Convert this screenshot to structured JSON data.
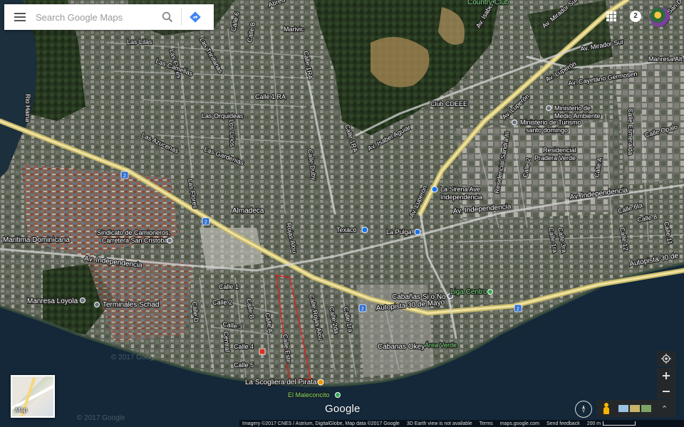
{
  "search": {
    "placeholder": "Search Google Maps"
  },
  "header": {
    "notification_count": "2"
  },
  "layer_switcher": {
    "label": "Map"
  },
  "logo": "Google",
  "watermarks": [
    "© 2017 Google",
    "© 2017 Google"
  ],
  "footer": {
    "imagery": "Imagery ©2017 CNES / Astrium, DigitalGlobe, Map data ©2017 Google",
    "earth_note": "3D Earth view is not available",
    "terms": "Terms",
    "url": "maps.google.com",
    "feedback": "Send feedback",
    "scale": "200 m"
  },
  "map": {
    "street_labels": {
      "calle_6": "Calle 6",
      "abreu": "Abreu",
      "marivic": "Marivic",
      "las_lilas": "Las Lilas",
      "las_flores_top": "Las Flores",
      "las_camelias": "Las Camelias",
      "las_trinitarias": "Las Trinitarias",
      "calle_b": "Calle B",
      "calle_1ra_v": "Calle 1RA",
      "calle_1ra_h": "Calle 1 RA",
      "las_orquideas": "Las Orquideas",
      "los_lirios": "Los Lirios",
      "las_azucenas": "Las Azucenas",
      "las_gardenias": "Las Gardenias",
      "calle_1ra_2": "Calle 1RA",
      "calle_duby": "Calle Duby",
      "las_flores_mid": "Las Flores",
      "rio_haina": "Rio Haina",
      "av_isabel_aguiar_top": "Av. Isabel Aguiar",
      "av_isabel_aguiar": "Av. Isabel Aguiar",
      "av_luperon_1": "Av. Luperón",
      "av_luperon_2": "Av. Luperón",
      "av_luperon_3": "Av. Luperón",
      "av_mirador_sur_1": "Av. Mirador Sur",
      "av_mirador_sur_2": "Av. Mirador Sur",
      "san_d": "San D",
      "manresa_alt": "Manresa Alt",
      "av_cayetano": "Av. Cayetano Germosen",
      "calle_esmeralda": "Calle Esmeralda",
      "calle_opalo": "Calle Opalo",
      "av_independencia_e1": "Av. Independencia",
      "av_independencia_e2": "Av. Independencia",
      "av_independencia_w": "Av. Independencia",
      "residencial_sandra": "Residencial Sandra III",
      "calle_2": "Calle 2",
      "calle_a_e": "Calle A",
      "calle_6ta": "Calle 6ta",
      "calle_8": "Calle 8",
      "calle_1ra_e": "Calle 1ra",
      "calle_3ra": "Calle 3ra",
      "calle_12": "Calle 12",
      "calle_11": "Calle 11",
      "autopista_30_mayo_e": "Autopista 30 de",
      "autopista_30_mayo": "Autopista 30 de Mayo",
      "rojas_alou_n": "Rojas Alou",
      "calle_rojas_alou": "Calle Rojas Alou",
      "calle_1ra_s": "Calle 1ra",
      "calle_2da": "Calle 2da",
      "calle_este": "Calle Este",
      "calle_1": "Calle 1",
      "calle_2_s": "Calle 2",
      "calle_3": "Calle 3",
      "calle_4": "Calle 4",
      "calle_5": "Calle 5",
      "calle_b_s": "Calle B",
      "calle_a_s": "Calle A",
      "calle_d": "Calle D",
      "central": "Central",
      "maritima": "Maritima Dominicana"
    },
    "poi_labels": {
      "country_club": "Country Club",
      "club_cdeee": "Club CDEEE",
      "ministerio_ambiente": "Ministerio de\nMedio Ambiente",
      "ministerio_turismo": "Ministerio de Turismo\nsanto domingo",
      "residencial_pradera": "Residencial\nPradera Verde",
      "la_sirena": "La Sirena Ave\nIndependencia",
      "almadeca": "Almadeca",
      "texaco": "Texaco",
      "la_pulga": "La Pulga",
      "sindicato": "Sindicato de Camioneros,\nCarretera San Cristobal",
      "manresa_loyola": "Manresa Loyola",
      "terminales_schad": "Terminales Schad",
      "cabanas_si_o_no": "Cabañas Si o No",
      "liga_centro": "Liga Centro",
      "cabanas_okey": "Cabanas Okey",
      "area_verde": "Área Verde",
      "la_scogliera": "La Scogliera del Pirata",
      "el_maleconcito": "El Maleconcito"
    },
    "route_shields": [
      "2",
      "2",
      "2",
      "2"
    ]
  },
  "colors": {
    "ocean": "#14283a",
    "land": "#3c4636",
    "highlight_outline": "#e0201b",
    "road_main": "#efe3a0"
  }
}
